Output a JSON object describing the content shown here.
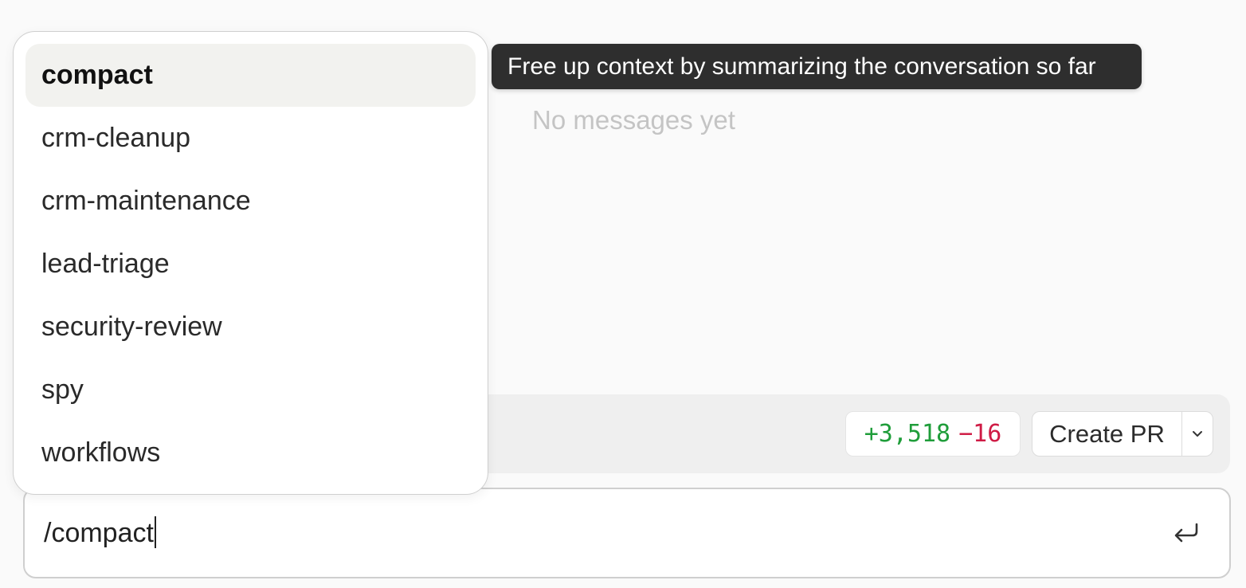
{
  "chat": {
    "empty_text": "No messages yet"
  },
  "tooltip": {
    "text": "Free up context by summarizing the conversation so far"
  },
  "slash_menu": {
    "items": [
      {
        "label": "compact",
        "active": true
      },
      {
        "label": "crm-cleanup",
        "active": false
      },
      {
        "label": "crm-maintenance",
        "active": false
      },
      {
        "label": "lead-triage",
        "active": false
      },
      {
        "label": "security-review",
        "active": false
      },
      {
        "label": "spy",
        "active": false
      },
      {
        "label": "workflows",
        "active": false
      }
    ]
  },
  "toolbar": {
    "additions": "+3,518",
    "deletions": "−16",
    "create_pr_label": "Create PR",
    "caret_icon": "chevron-down-icon"
  },
  "composer": {
    "value": "/compact",
    "send_icon": "enter-return-icon"
  },
  "colors": {
    "additions": "#1f9d3a",
    "deletions": "#cf1b45",
    "tooltip_bg": "#2e2e2e",
    "active_item_bg": "#f2f2ef"
  }
}
